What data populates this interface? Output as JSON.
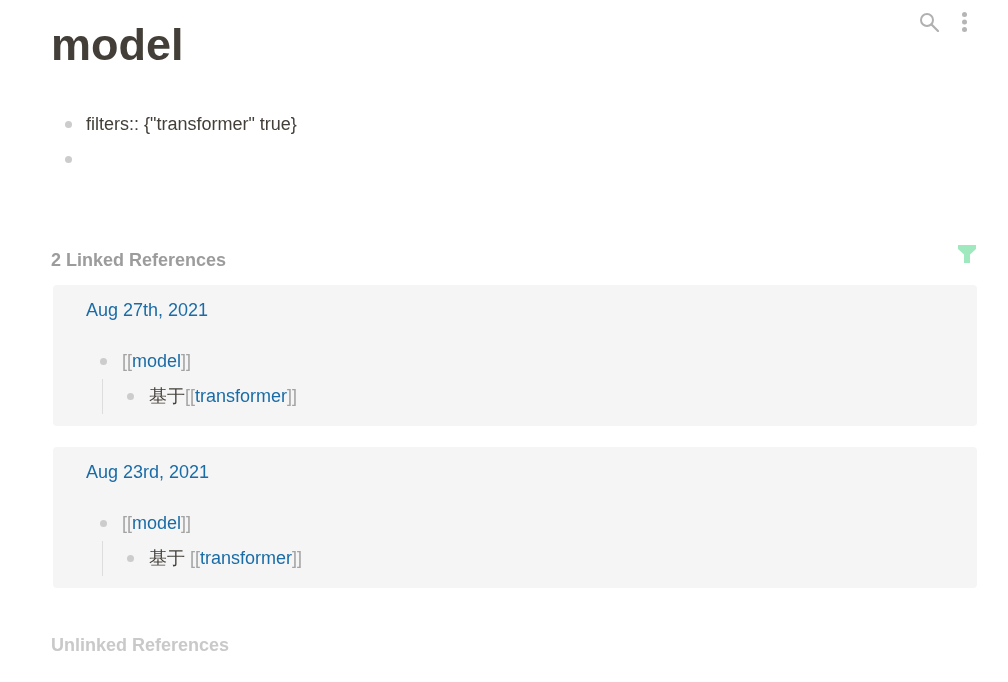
{
  "page": {
    "title": "model"
  },
  "blocks": [
    {
      "kind": "text",
      "text": "filters:: {\"transformer\" true}"
    },
    {
      "kind": "empty"
    }
  ],
  "linked_references": {
    "title": "2 Linked References",
    "filter_active": true,
    "groups": [
      {
        "page": "Aug 27th, 2021",
        "blocks": [
          {
            "segments": [
              {
                "kind": "ref",
                "open": "[[",
                "label": "model",
                "close": "]]"
              }
            ],
            "children": [
              {
                "segments": [
                  {
                    "kind": "text",
                    "text": "基于"
                  },
                  {
                    "kind": "ref",
                    "open": "[[",
                    "label": "transformer",
                    "close": "]]"
                  }
                ]
              }
            ]
          }
        ]
      },
      {
        "page": "Aug 23rd, 2021",
        "blocks": [
          {
            "segments": [
              {
                "kind": "ref",
                "open": "[[",
                "label": "model",
                "close": "]]"
              }
            ],
            "children": [
              {
                "segments": [
                  {
                    "kind": "text",
                    "text": "基于 "
                  },
                  {
                    "kind": "ref",
                    "open": "[[",
                    "label": "transformer",
                    "close": "]]"
                  }
                ]
              }
            ]
          }
        ]
      }
    ]
  },
  "unlinked_references": {
    "title": "Unlinked References"
  }
}
